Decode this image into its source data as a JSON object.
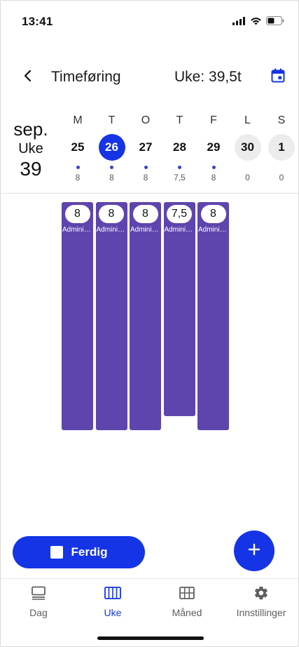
{
  "status_bar": {
    "time": "13:41",
    "icons": [
      "signal-icon",
      "wifi-icon",
      "battery-icon"
    ]
  },
  "header": {
    "back_icon": "chevron-left-icon",
    "title": "Timeføring",
    "week_total": "Uke: 39,5t",
    "calendar_icon": "calendar-icon"
  },
  "week": {
    "month": "sep.",
    "week_label": "Uke",
    "week_number": "39",
    "days": [
      {
        "letter": "M",
        "date": "25",
        "hours": "8",
        "has_entries": true,
        "state": "normal"
      },
      {
        "letter": "T",
        "date": "26",
        "hours": "8",
        "has_entries": true,
        "state": "selected"
      },
      {
        "letter": "O",
        "date": "27",
        "hours": "8",
        "has_entries": true,
        "state": "normal"
      },
      {
        "letter": "T",
        "date": "28",
        "hours": "7,5",
        "has_entries": true,
        "state": "normal"
      },
      {
        "letter": "F",
        "date": "29",
        "hours": "8",
        "has_entries": true,
        "state": "normal"
      },
      {
        "letter": "L",
        "date": "30",
        "hours": "0",
        "has_entries": false,
        "state": "weekend"
      },
      {
        "letter": "S",
        "date": "1",
        "hours": "0",
        "has_entries": false,
        "state": "weekend"
      }
    ]
  },
  "entries": [
    {
      "hours": "8",
      "hours_value": 8,
      "label": "Administ..."
    },
    {
      "hours": "8",
      "hours_value": 8,
      "label": "Administ..."
    },
    {
      "hours": "8",
      "hours_value": 8,
      "label": "Administ..."
    },
    {
      "hours": "7,5",
      "hours_value": 7.5,
      "label": "Administ..."
    },
    {
      "hours": "8",
      "hours_value": 8,
      "label": "Administ..."
    }
  ],
  "actions": {
    "done_label": "Ferdig",
    "done_icon": "checkbox-icon",
    "add_icon": "plus-icon"
  },
  "nav": {
    "items": [
      {
        "label": "Dag",
        "icon": "day-icon",
        "active": false
      },
      {
        "label": "Uke",
        "icon": "week-icon",
        "active": true
      },
      {
        "label": "Måned",
        "icon": "month-grid-icon",
        "active": false
      },
      {
        "label": "Innstillinger",
        "icon": "gear-icon",
        "active": false
      }
    ]
  },
  "colors": {
    "accent": "#1534e6",
    "bar": "#5e45ad",
    "dot": "#3a3fd4",
    "weekend_bg": "#ececec"
  }
}
